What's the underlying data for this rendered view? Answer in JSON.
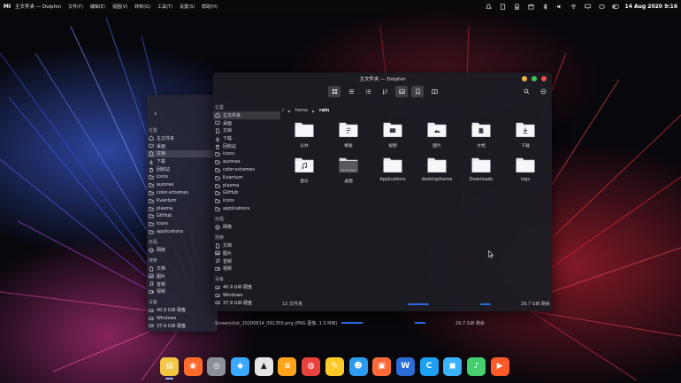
{
  "topbar": {
    "logo": "MI",
    "window_title": "主文件夹 — Dolphin",
    "menus": [
      "文件(F)",
      "编辑(E)",
      "视图(V)",
      "转到(G)",
      "工具(T)",
      "设置(S)",
      "帮助(H)"
    ],
    "clock": "14 Aug 2020 9:16",
    "tray_icons": [
      "bell-icon",
      "clipboard-icon",
      "battery-icon",
      "calendar-icon",
      "bluetooth-icon",
      "volume-icon",
      "wifi-icon",
      "display-icon",
      "storage-icon",
      "toggle-icon"
    ]
  },
  "window": {
    "title": "主文件夹 — Dolphin",
    "button_colors": [
      "#f0b43c",
      "#3cc45a",
      "#ee4e4e"
    ]
  },
  "breadcrumb": {
    "root": "/",
    "parts": [
      "home",
      "rain"
    ]
  },
  "sidebar": {
    "sections": {
      "places": "位置",
      "remote": "远程",
      "search": "搜索",
      "devices": "设备"
    },
    "places": [
      "主文件夹",
      "桌面",
      "文档",
      "下载",
      "回收站",
      "icons",
      "aurorae",
      "color-schemes",
      "Kvantum",
      "plasma",
      "GitHub",
      "icons",
      "applications"
    ],
    "remote": [
      "网络"
    ],
    "search": [
      "文档",
      "图片",
      "音频",
      "视频"
    ],
    "devices": [
      "40.9 GiB 硬盘",
      "Windows",
      "37.9 GiB 硬盘"
    ]
  },
  "back_sidebar": {
    "places": [
      "主文件夹",
      "桌面",
      "文档",
      "下载",
      "回收站",
      "icons",
      "aurorae",
      "color-schemes",
      "Kvantum",
      "plasma",
      "GitHub",
      "icons",
      "applications"
    ],
    "remote": [
      "网络"
    ],
    "search": [
      "文档",
      "图片",
      "音频",
      "视频"
    ],
    "devices": [
      "40.9 GiB 硬盘",
      "Windows",
      "37.9 GiB 硬盘"
    ]
  },
  "files": [
    {
      "name": "公共",
      "icon": "folder-icon"
    },
    {
      "name": "模板",
      "icon": "folder-template-icon"
    },
    {
      "name": "视频",
      "icon": "folder-videos-icon"
    },
    {
      "name": "图片",
      "icon": "folder-pictures-icon"
    },
    {
      "name": "文档",
      "icon": "folder-documents-icon"
    },
    {
      "name": "下载",
      "icon": "folder-downloads-icon"
    },
    {
      "name": "音乐",
      "icon": "folder-music-icon"
    },
    {
      "name": "桌面",
      "icon": "folder-desktop-icon"
    },
    {
      "name": "Applications",
      "icon": "folder-icon"
    },
    {
      "name": "desktoptheme",
      "icon": "folder-icon"
    },
    {
      "name": "Downloads",
      "icon": "folder-icon"
    },
    {
      "name": "logs",
      "icon": "folder-icon"
    }
  ],
  "status": {
    "count": "12 文件夹",
    "free": "29.7 GiB 剩余"
  },
  "bottom_info": {
    "filename": "Screenshot_20200814_091350.png (PNG 图像, 1.3 MiB)",
    "free": "29.7 GiB 剩余"
  },
  "dock": [
    {
      "name": "files",
      "color": "#f3c644",
      "glyph": "▤"
    },
    {
      "name": "firefox",
      "color": "#ff6a2a",
      "glyph": "◉"
    },
    {
      "name": "chrome",
      "color": "#8a8f98",
      "glyph": "◎"
    },
    {
      "name": "qq",
      "color": "#3aa9ff",
      "glyph": "◆"
    },
    {
      "name": "inkscape",
      "color": "#e6e6e6",
      "glyph": "▲"
    },
    {
      "name": "memo",
      "color": "#ffa31a",
      "glyph": "≡"
    },
    {
      "name": "weibo",
      "color": "#e8423c",
      "glyph": "◍"
    },
    {
      "name": "notes",
      "color": "#ffc928",
      "glyph": "✎"
    },
    {
      "name": "github",
      "color": "#2d9bf0",
      "glyph": "☻"
    },
    {
      "name": "store",
      "color": "#ff6a3a",
      "glyph": "▣"
    },
    {
      "name": "word",
      "color": "#2b6cd6",
      "glyph": "W"
    },
    {
      "name": "browser",
      "color": "#1da1f2",
      "glyph": "C"
    },
    {
      "name": "chat",
      "color": "#3ab2ff",
      "glyph": "◼"
    },
    {
      "name": "music",
      "color": "#46cf6e",
      "glyph": "♪"
    },
    {
      "name": "video",
      "color": "#ff5a2a",
      "glyph": "▶"
    }
  ]
}
